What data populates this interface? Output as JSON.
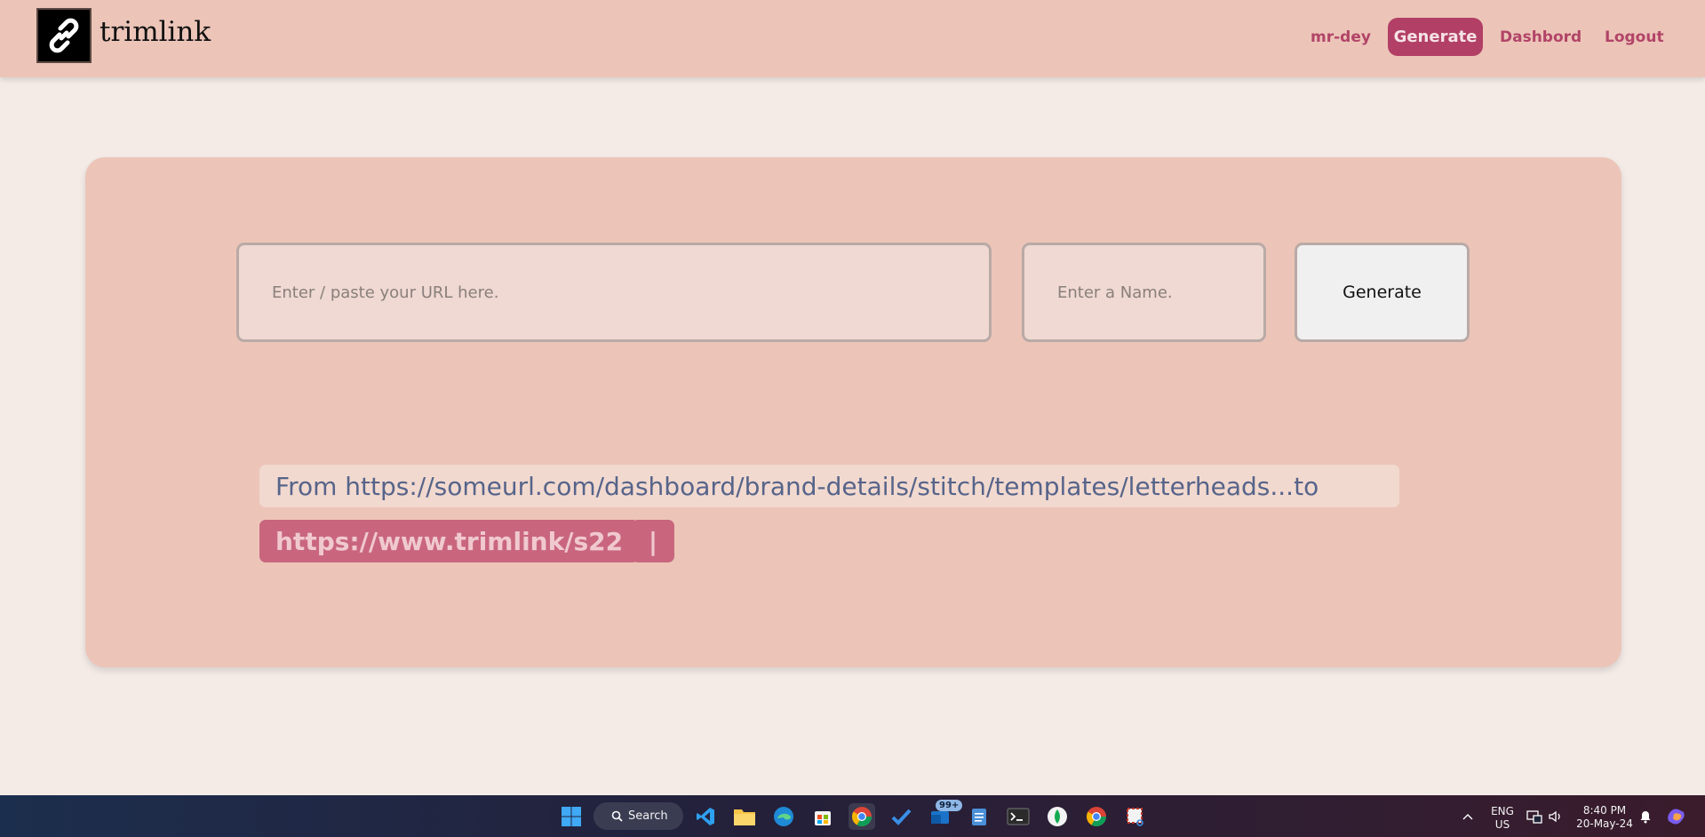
{
  "app": {
    "logo_text": "trimlink"
  },
  "nav": {
    "username": "mr-dey",
    "generate": "Generate",
    "dashboard": "Dashbord",
    "logout": "Logout"
  },
  "form": {
    "url_placeholder": "Enter / paste your URL here.",
    "name_placeholder": "Enter a Name.",
    "generate_button": "Generate"
  },
  "result": {
    "from_text": "From https://someurl.com/dashboard/brand-details/stitch/templates/letterheads...to",
    "short_link": "https://www.trimlink/s22",
    "copy_label": "|"
  },
  "taskbar": {
    "search_label": "Search",
    "mail_badge": "99+",
    "lang_line1": "ENG",
    "lang_line2": "US",
    "time": "8:40 PM",
    "date": "20-May-24"
  },
  "colors": {
    "header_bg": "#ecc5b8",
    "accent": "#b23f66",
    "page_bg": "#f4ebe7"
  }
}
